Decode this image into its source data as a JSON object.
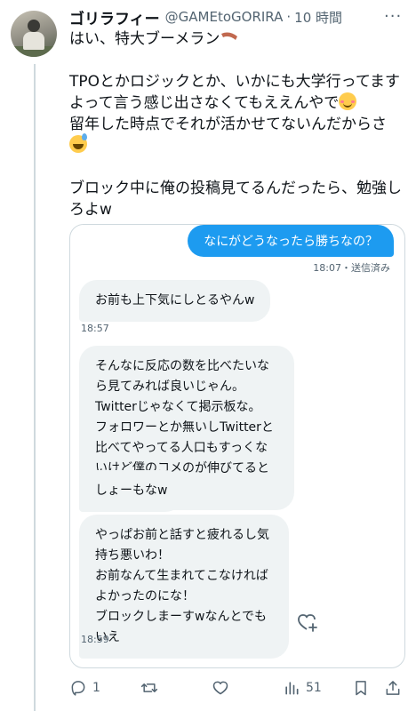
{
  "post": {
    "author_name": "ゴリラフィー",
    "handle": "@GAMEtoGORIRA",
    "separator": "·",
    "time": "10 時間",
    "more_label": "···",
    "text_line1": "はい、特大ブーメラン",
    "text_para2_part1": "TPOとかロジックとか、いかにも大学行ってますよって言う感じ出さなくてもええんやで",
    "text_para2_part2": "\n留年した時点でそれが活かせてないんだからさ",
    "text_para3": "ブロック中に俺の投稿見てるんだったら、勉強しろよw",
    "emojis": [
      "boomerang",
      "relieved-face",
      "grinning-face-with-sweat"
    ]
  },
  "dm_screenshot": {
    "outgoing": {
      "text": "なにがどうなったら勝ちなの？",
      "time": "18:07",
      "status": "・送信済み"
    },
    "incoming": [
      {
        "text": "お前も上下気にしとるやんw",
        "time": "18:57"
      },
      {
        "text": "そんなに反応の数を比べたいなら見てみれば良いじゃん。\nTwitterじゃなくて掲示板な。\nフォロワーとか無いしTwitterと比べてやってる人口もすっくないけど僕のコメのが伸びてると思うで",
        "time": ""
      },
      {
        "text": "しょーもなw",
        "time": ""
      },
      {
        "text": "やっぱお前と話すと疲れるし気持ち悪いわ！\nお前なんて生まれてこなければよかったのにな！\nブロックしまーすwなんとでもいえ",
        "time": "18:59"
      }
    ],
    "reaction_icon": "heart-plus-icon"
  },
  "actions": {
    "reply_count": "1",
    "retweet_count": "",
    "like_count": "",
    "views_count": "51",
    "icons": [
      "reply-icon",
      "retweet-icon",
      "like-icon",
      "views-icon",
      "bookmark-icon",
      "share-icon"
    ]
  },
  "colors": {
    "accent": "#1d9bf0",
    "text": "#0f1419",
    "secondary": "#536471",
    "bubble_in": "#eff3f4"
  }
}
